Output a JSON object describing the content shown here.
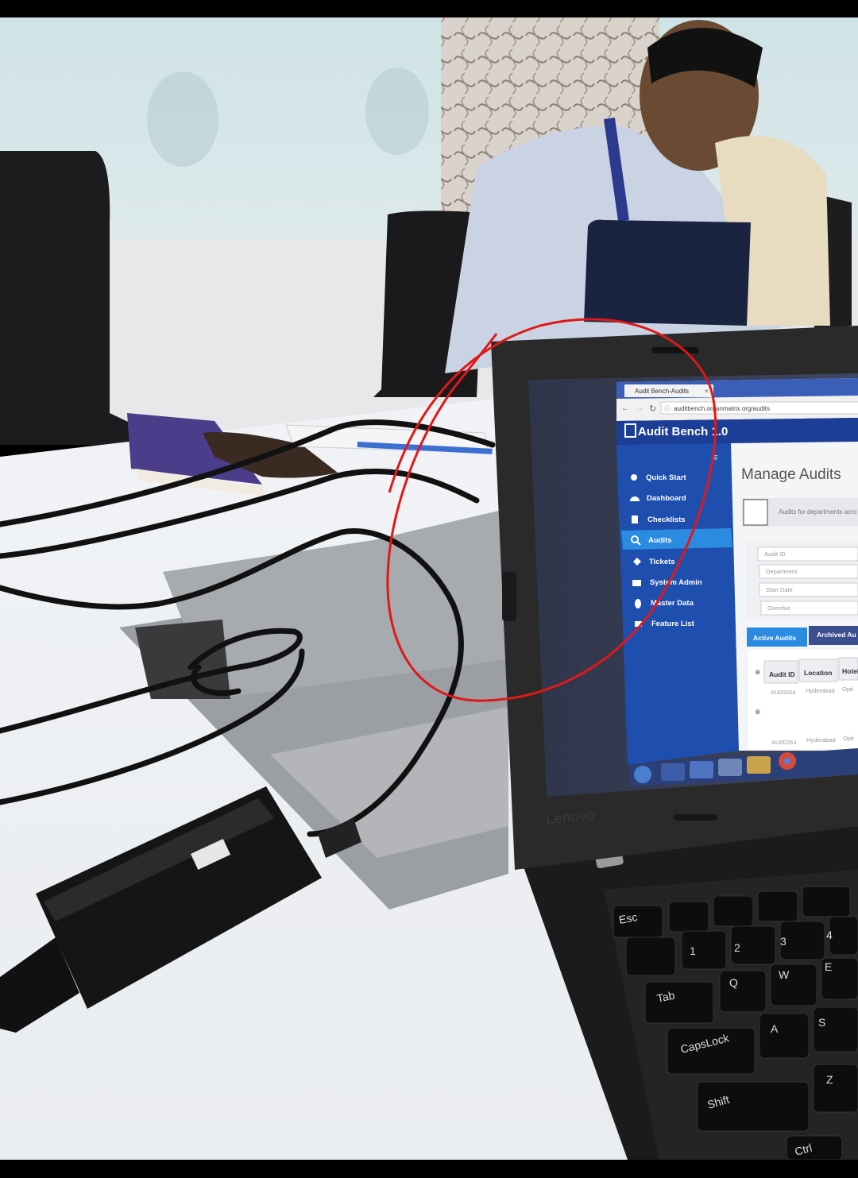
{
  "browser": {
    "tab_title": "Audit Bench-Audits",
    "url": "auditbench.organmatrix.org/audits"
  },
  "app": {
    "title": "Audit Bench 1.0",
    "page_heading": "Manage Audits",
    "info_text": "Audits for departments acro",
    "nav": [
      {
        "label": "Quick Start",
        "icon": "plus-circle-icon"
      },
      {
        "label": "Dashboard",
        "icon": "gauge-icon"
      },
      {
        "label": "Checklists",
        "icon": "clipboard-icon"
      },
      {
        "label": "Audits",
        "icon": "search-icon",
        "active": true
      },
      {
        "label": "Tickets",
        "icon": "tag-icon"
      },
      {
        "label": "System Admin",
        "icon": "admin-icon"
      },
      {
        "label": "Master Data",
        "icon": "database-icon"
      },
      {
        "label": "Feature List",
        "icon": "list-icon"
      }
    ],
    "filters": [
      "Audit ID",
      "Department",
      "Start Date",
      "Overdue"
    ],
    "tabs": [
      "Active Audits",
      "Archived Au"
    ],
    "table_headers": [
      "Audit ID",
      "Location",
      "Hotel"
    ],
    "table_rows": [
      [
        "AU00264",
        "Hyderabad",
        "Opti"
      ],
      [
        "AU00263",
        "Hyderabad",
        "Opti"
      ]
    ]
  },
  "laptop": {
    "brand": "Lenovo",
    "keys": [
      "Esc",
      "Tab",
      "CapsLock",
      "Shift",
      "Ctrl",
      "Q",
      "W",
      "E",
      "A",
      "S",
      "Z",
      "1",
      "2",
      "3",
      "4"
    ]
  },
  "colors": {
    "sidebar": "#1f4fae",
    "sidebar_active": "#2a8be0",
    "tab_active": "#2a8be0",
    "annotation": "#e01818"
  }
}
